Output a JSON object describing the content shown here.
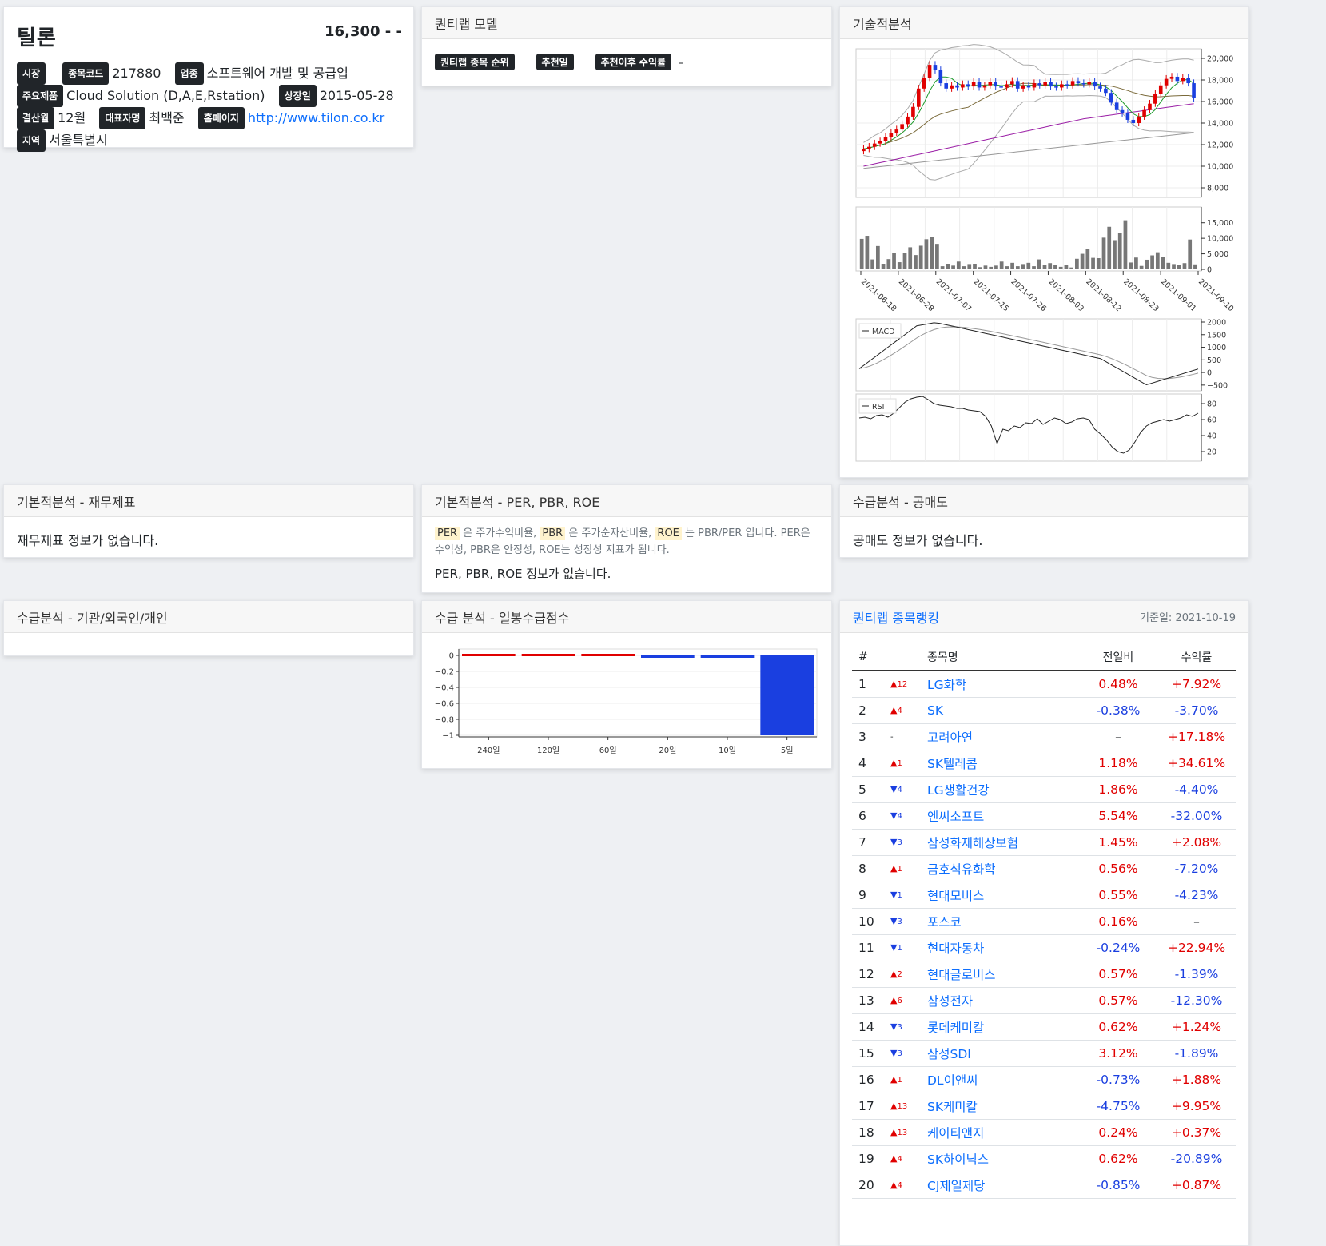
{
  "stock": {
    "name": "틸론",
    "price": "16,300",
    "change": "- -",
    "market_label": "시장",
    "code_label": "종목코드",
    "code": "217880",
    "industry_label": "업종",
    "industry": "소프트웨어 개발 및 공급업",
    "product_label": "주요제품",
    "product": "Cloud Solution (D,A,E,Rstation)",
    "listed_label": "상장일",
    "listed": "2015-05-28",
    "fiscal_label": "결산월",
    "fiscal": "12월",
    "ceo_label": "대표자명",
    "ceo": "최백준",
    "homepage_label": "홈페이지",
    "homepage": "http://www.tilon.co.kr",
    "region_label": "지역",
    "region": "서울특별시"
  },
  "quant_model": {
    "title": "퀀티랩 모델",
    "rank_label": "퀀티랩 종목 순위",
    "rec_date_label": "추천일",
    "rec_return_label": "추천이후 수익률",
    "rec_return_value": "–"
  },
  "tech": {
    "title": "기술적분석"
  },
  "financial": {
    "title": "기본적분석 - 재무제표",
    "empty": "재무제표 정보가 없습니다."
  },
  "per": {
    "title": "기본적분석 - PER, PBR, ROE",
    "per_tag": "PER",
    "per_desc": "은 주가수익비율,",
    "pbr_tag": "PBR",
    "pbr_desc": "은 주가순자산비율,",
    "roe_tag": "ROE",
    "roe_desc": "는 PBR/PER 입니다. PER은",
    "desc_line2": "수익성, PBR은 안정성, ROE는 성장성 지표가 됩니다.",
    "empty": "PER, PBR, ROE 정보가 없습니다."
  },
  "short": {
    "title": "수급분석 - 공매도",
    "empty": "공매도 정보가 없습니다."
  },
  "investor": {
    "title": "수급분석 - 기관/외국인/개인"
  },
  "supply": {
    "title": "수급 분석 - 일봉수급점수"
  },
  "ranking": {
    "title": "퀀티랩 종목랭킹",
    "date": "기준일: 2021-10-19",
    "headers": [
      "#",
      "종목명",
      "전일비",
      "수익률"
    ],
    "rows": [
      {
        "n": "1",
        "dir": "up",
        "chg": "12",
        "name": "LG화학",
        "day": "0.48%",
        "day_dir": "up",
        "ret": "+7.92%",
        "ret_dir": "up"
      },
      {
        "n": "2",
        "dir": "up",
        "chg": "4",
        "name": "SK",
        "day": "-0.38%",
        "day_dir": "down",
        "ret": "-3.70%",
        "ret_dir": "down"
      },
      {
        "n": "3",
        "dir": "none",
        "chg": "-",
        "name": "고려아연",
        "day": "–",
        "day_dir": "none",
        "ret": "+17.18%",
        "ret_dir": "up"
      },
      {
        "n": "4",
        "dir": "up",
        "chg": "1",
        "name": "SK텔레콤",
        "day": "1.18%",
        "day_dir": "up",
        "ret": "+34.61%",
        "ret_dir": "up"
      },
      {
        "n": "5",
        "dir": "down",
        "chg": "4",
        "name": "LG생활건강",
        "day": "1.86%",
        "day_dir": "up",
        "ret": "-4.40%",
        "ret_dir": "down"
      },
      {
        "n": "6",
        "dir": "down",
        "chg": "4",
        "name": "엔씨소프트",
        "day": "5.54%",
        "day_dir": "up",
        "ret": "-32.00%",
        "ret_dir": "down"
      },
      {
        "n": "7",
        "dir": "down",
        "chg": "3",
        "name": "삼성화재해상보험",
        "day": "1.45%",
        "day_dir": "up",
        "ret": "+2.08%",
        "ret_dir": "up"
      },
      {
        "n": "8",
        "dir": "up",
        "chg": "1",
        "name": "금호석유화학",
        "day": "0.56%",
        "day_dir": "up",
        "ret": "-7.20%",
        "ret_dir": "down"
      },
      {
        "n": "9",
        "dir": "down",
        "chg": "1",
        "name": "현대모비스",
        "day": "0.55%",
        "day_dir": "up",
        "ret": "-4.23%",
        "ret_dir": "down"
      },
      {
        "n": "10",
        "dir": "down",
        "chg": "3",
        "name": "포스코",
        "day": "0.16%",
        "day_dir": "up",
        "ret": "–",
        "ret_dir": "none"
      },
      {
        "n": "11",
        "dir": "down",
        "chg": "1",
        "name": "현대자동차",
        "day": "-0.24%",
        "day_dir": "down",
        "ret": "+22.94%",
        "ret_dir": "up"
      },
      {
        "n": "12",
        "dir": "up",
        "chg": "2",
        "name": "현대글로비스",
        "day": "0.57%",
        "day_dir": "up",
        "ret": "-1.39%",
        "ret_dir": "down"
      },
      {
        "n": "13",
        "dir": "up",
        "chg": "6",
        "name": "삼성전자",
        "day": "0.57%",
        "day_dir": "up",
        "ret": "-12.30%",
        "ret_dir": "down"
      },
      {
        "n": "14",
        "dir": "down",
        "chg": "3",
        "name": "롯데케미칼",
        "day": "0.62%",
        "day_dir": "up",
        "ret": "+1.24%",
        "ret_dir": "up"
      },
      {
        "n": "15",
        "dir": "down",
        "chg": "3",
        "name": "삼성SDI",
        "day": "3.12%",
        "day_dir": "up",
        "ret": "-1.89%",
        "ret_dir": "down"
      },
      {
        "n": "16",
        "dir": "up",
        "chg": "1",
        "name": "DL이앤씨",
        "day": "-0.73%",
        "day_dir": "down",
        "ret": "+1.88%",
        "ret_dir": "up"
      },
      {
        "n": "17",
        "dir": "up",
        "chg": "13",
        "name": "SK케미칼",
        "day": "-4.75%",
        "day_dir": "down",
        "ret": "+9.95%",
        "ret_dir": "up"
      },
      {
        "n": "18",
        "dir": "up",
        "chg": "13",
        "name": "케이티앤지",
        "day": "0.24%",
        "day_dir": "up",
        "ret": "+0.37%",
        "ret_dir": "up"
      },
      {
        "n": "19",
        "dir": "up",
        "chg": "4",
        "name": "SK하이닉스",
        "day": "0.62%",
        "day_dir": "up",
        "ret": "-20.89%",
        "ret_dir": "down"
      },
      {
        "n": "20",
        "dir": "up",
        "chg": "4",
        "name": "CJ제일제당",
        "day": "-0.85%",
        "day_dir": "down",
        "ret": "+0.87%",
        "ret_dir": "up"
      }
    ]
  },
  "colors": {
    "up": "#e00000",
    "down": "#1a3fe0",
    "link": "#0d6efd"
  },
  "chart_data": [
    {
      "type": "candlestick",
      "title": "",
      "ylim": [
        8000,
        20000
      ],
      "yticks": [
        "8,000",
        "10,000",
        "12,000",
        "14,000",
        "16,000",
        "18,000",
        "20,000"
      ],
      "close": [
        11600,
        11800,
        12100,
        12300,
        12700,
        13100,
        13400,
        13900,
        14600,
        15500,
        17200,
        18200,
        19400,
        18900,
        17700,
        17200,
        17500,
        17300,
        17600,
        17400,
        17800,
        17300,
        17500,
        17800,
        17400,
        17300,
        17600,
        17900,
        17200,
        17500,
        17300,
        17700,
        17500,
        17800,
        17400,
        17300,
        17600,
        17500,
        17900,
        17700,
        17600,
        17800,
        17400,
        17200,
        16800,
        15900,
        15200,
        14900,
        14300,
        14000,
        14600,
        15200,
        15800,
        16700,
        17500,
        18100,
        18300,
        17900,
        18200,
        17700,
        16300
      ]
    },
    {
      "type": "bar",
      "title": "",
      "ylim": [
        0,
        17500
      ],
      "yticks": [
        "0",
        "5,000",
        "10,000",
        "15,000"
      ],
      "xticks": [
        "2021-06-18",
        "2021-06-28",
        "2021-07-07",
        "2021-07-15",
        "2021-07-26",
        "2021-08-03",
        "2021-08-12",
        "2021-08-23",
        "2021-09-01",
        "2021-09-10"
      ],
      "values": [
        9800,
        10800,
        3200,
        7500,
        1800,
        3300,
        5300,
        2300,
        5400,
        7100,
        4600,
        7600,
        9700,
        10300,
        8200,
        1000,
        1800,
        1200,
        2500,
        1000,
        1700,
        1800,
        700,
        1200,
        800,
        1200,
        2500,
        1000,
        2100,
        1000,
        1700,
        2100,
        1000,
        3200,
        1400,
        2000,
        1400,
        800,
        1400,
        600,
        3400,
        5000,
        6600,
        3700,
        3600,
        10200,
        13700,
        9400,
        11700,
        15800,
        2200,
        3800,
        1100,
        3100,
        4500,
        5500,
        4000,
        2100,
        1700,
        1400,
        2000,
        9600,
        1600
      ]
    },
    {
      "type": "line",
      "title": "",
      "legend": [
        "MACD"
      ],
      "ylim": [
        -600,
        2000
      ],
      "yticks": [
        "−500",
        "0",
        "500",
        "1000",
        "1500",
        "2000"
      ]
    },
    {
      "type": "line",
      "title": "",
      "legend": [
        "RSI"
      ],
      "ylim": [
        10,
        90
      ],
      "yticks": [
        "20",
        "40",
        "60",
        "80"
      ]
    },
    {
      "type": "bar",
      "title": "",
      "categories": [
        "240일",
        "120일",
        "60일",
        "20일",
        "10일",
        "5일"
      ],
      "values": [
        0.01,
        0.01,
        0.01,
        -0.01,
        -0.02,
        -1.0
      ],
      "ylim": [
        -1,
        0.05
      ],
      "yticks": [
        "0",
        "−0.2",
        "−0.4",
        "−0.6",
        "−0.8",
        "−1"
      ]
    }
  ]
}
